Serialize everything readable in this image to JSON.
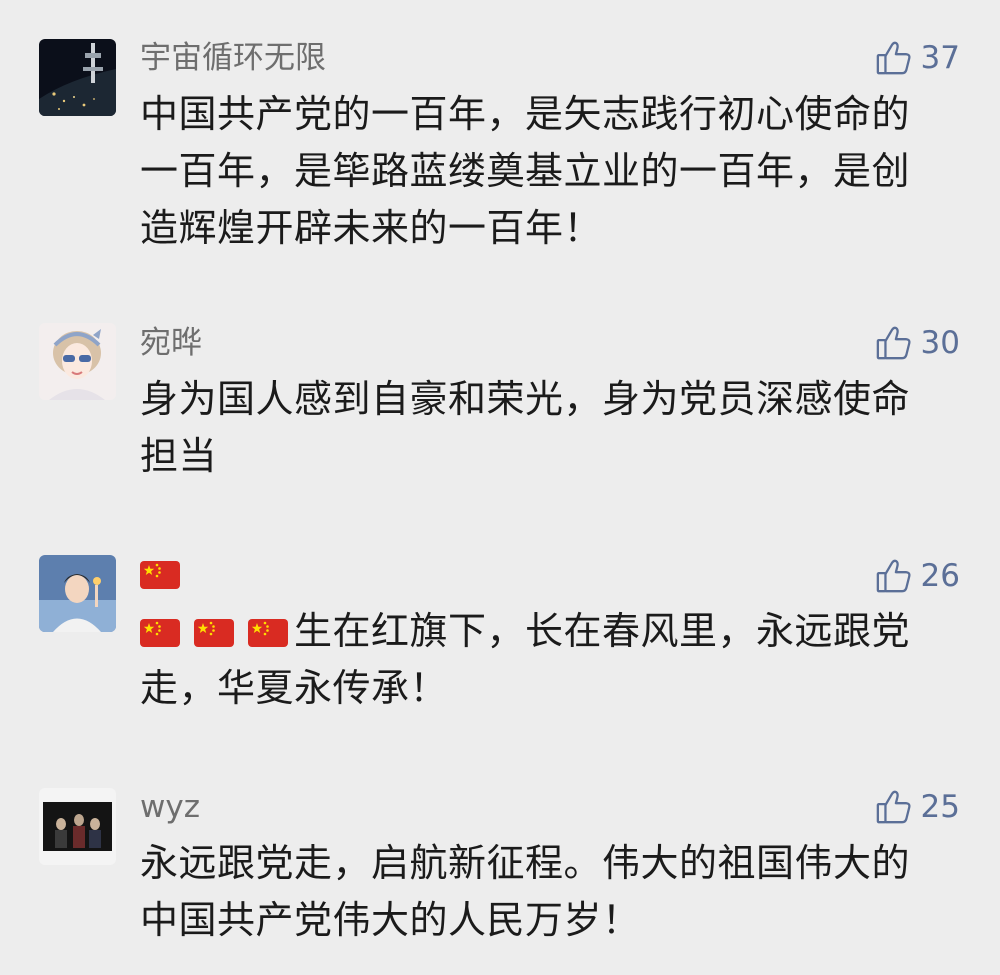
{
  "comments": [
    {
      "username": "宇宙循环无限",
      "likes": "37",
      "lines": [
        "中国共产党的一百年，是矢志践行初心使命的",
        "一百年，是筚路蓝缕奠基立业的一百年，是创",
        "造辉煌开辟未来的一百年！"
      ],
      "avatar_icon": "space-station-avatar-icon"
    },
    {
      "username": "宛晔",
      "likes": "30",
      "lines": [
        "身为国人感到自豪和荣光，身为党员深感使命",
        "担当"
      ],
      "avatar_icon": "girl-with-sunglasses-avatar-icon"
    },
    {
      "username": "",
      "likes": "26",
      "name_flag_icon": "china-flag-icon",
      "lines": [
        "生在红旗下，长在春风里，永远跟党",
        "走，华夏永传承！"
      ],
      "line1_prefix_flags": [
        "china-flag-icon",
        "china-flag-icon",
        "china-flag-icon"
      ],
      "avatar_icon": "illustrated-boy-avatar-icon"
    },
    {
      "username": "wyz",
      "likes": "25",
      "lines": [
        "永远跟党走，启航新征程。伟大的祖国伟大的",
        "中国共产党伟大的人民万岁！"
      ],
      "avatar_icon": "dark-photo-avatar-icon"
    }
  ],
  "colors": {
    "background": "#ededed",
    "username": "#6e6e6e",
    "like": "#5b6f97",
    "text": "#1b1b1b",
    "flag_red": "#d92b22",
    "flag_star": "#ffde00"
  }
}
